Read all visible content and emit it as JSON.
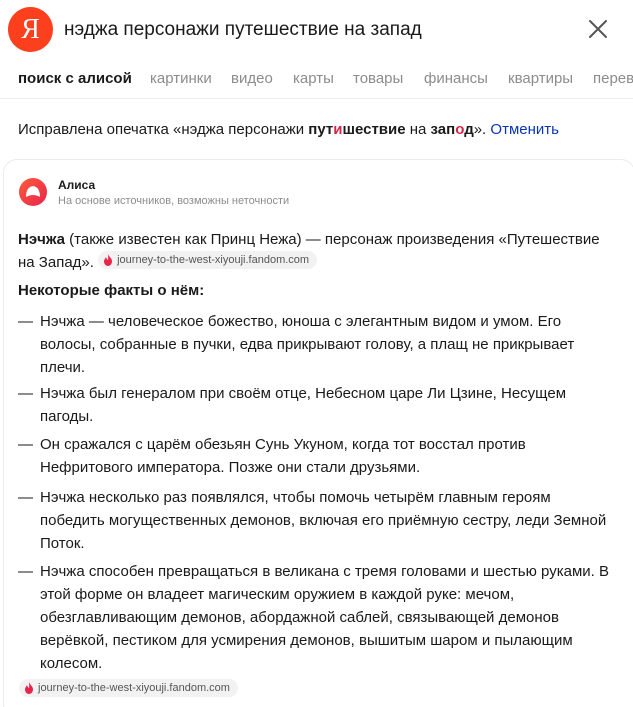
{
  "search": {
    "logo_letter": "Я",
    "query": "нэджа персонажи путешествие на запад"
  },
  "tabs": [
    {
      "label": "поиск с алисой"
    },
    {
      "label": "картинки"
    },
    {
      "label": "видео"
    },
    {
      "label": "карты"
    },
    {
      "label": "товары"
    },
    {
      "label": "финансы"
    },
    {
      "label": "квартиры"
    },
    {
      "label": "перев"
    }
  ],
  "correction": {
    "prefix": "Исправлена опечатка «нэджа персонажи ",
    "w1a": "пут",
    "w1b": "и",
    "w1c": "шествие",
    "mid": " на ",
    "w2a": "зап",
    "w2b": "о",
    "w2c": "д",
    "suffix": "». ",
    "cancel": "Отменить"
  },
  "alice": {
    "name": "Алиса",
    "subtitle": "На основе источников, возможны неточности"
  },
  "answer": {
    "intro_bold": "Нэчжа",
    "intro_rest": " (также известен как Принц Нежа) — персонаж произведения «Путешествие на Запад».",
    "facts_heading": "Некоторые факты о нём:",
    "dash": "—",
    "facts": [
      {
        "text": "Нэчжа — человеческое божество, юноша с элегантным видом и умом. Его волосы, собранные в пучки, едва прикрывают голову, а плащ не прикрывает плечи."
      },
      {
        "text": "Нэчжа был генералом при своём отце, Небесном царе Ли Цзине, Несущем пагоды."
      },
      {
        "text": "Он сражался с царём обезьян Сунь Укуном, когда тот восстал против Нефритового императора. Позже они стали друзьями."
      },
      {
        "text": "Нэчжа несколько раз появлялся, чтобы помочь четырём главным героям победить могущественных демонов, включая его приёмную сестру, леди Земной Поток."
      },
      {
        "text": "Нэчжа способен превращаться в великана с тремя головами и шестью руками. В этой форме он владеет магическим оружием в каждой руке: мечом, обезглавливающим демонов, абордажной саблей, связывающей демонов верёвкой, пестиком для усмирения демонов, вышитым шаром и пылающим колесом."
      }
    ],
    "source": "journey-to-the-west-xiyouji.fandom.com"
  },
  "colors": {
    "brand_red": "#fc3f1d",
    "link_blue": "#0c35b7",
    "correction_red": "#d6264a",
    "alice_purple": "#8a4dff"
  }
}
